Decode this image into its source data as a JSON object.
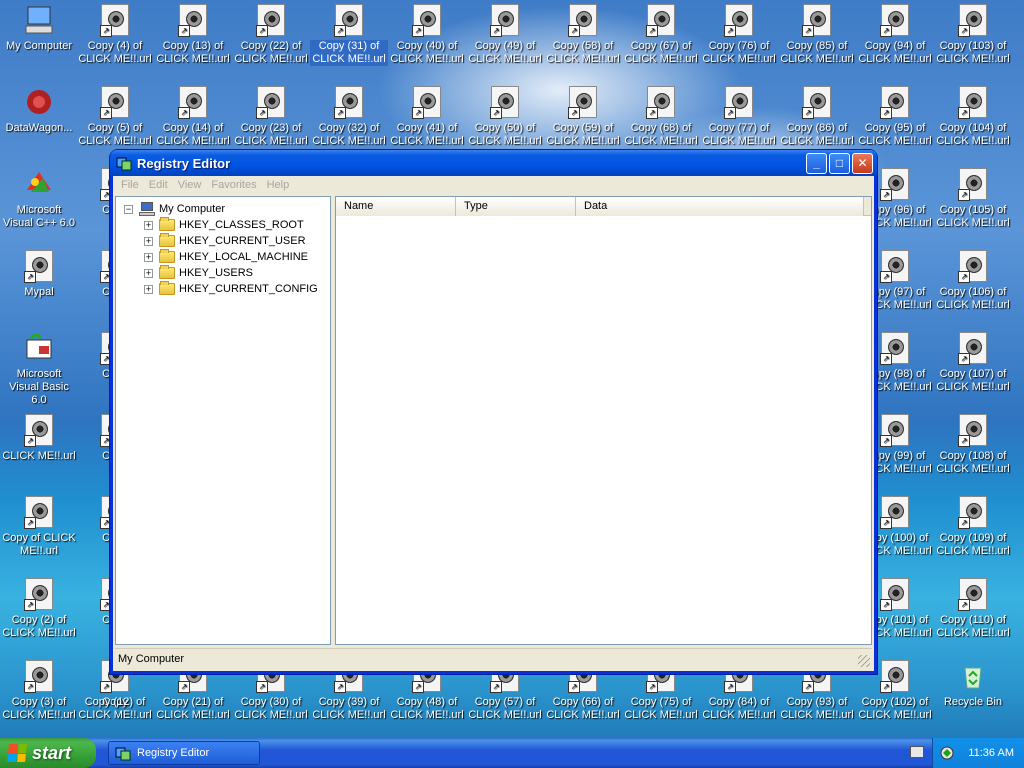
{
  "desktop": {
    "left_icons": [
      {
        "label": "My Computer",
        "icon": "my-computer-icon"
      },
      {
        "label": "DataWagon...",
        "icon": "datawagon-icon"
      },
      {
        "label": "Microsoft Visual C++ 6.0",
        "icon": "visual-cpp-icon"
      },
      {
        "label": "Mypal",
        "icon": "mypal-icon"
      },
      {
        "label": "Microsoft Visual Basic 6.0",
        "icon": "visual-basic-icon"
      },
      {
        "label": "CLICK ME!!.url",
        "icon": "url-shortcut-icon"
      },
      {
        "label": "Copy of CLICK ME!!.url",
        "icon": "url-shortcut-icon"
      },
      {
        "label": "Copy (2) of CLICK ME!!.url",
        "icon": "url-shortcut-icon"
      },
      {
        "label": "Copy (3) of CLICK ME!!.url",
        "icon": "url-shortcut-icon"
      }
    ],
    "top_row": [
      "Copy (4) of CLICK ME!!.url",
      "Copy (13) of CLICK ME!!.url",
      "Copy (22) of CLICK ME!!.url",
      "Copy (31) of CLICK ME!!.url",
      "Copy (40) of CLICK ME!!.url",
      "Copy (49) of CLICK ME!!.url",
      "Copy (58) of CLICK ME!!.url",
      "Copy (67) of CLICK ME!!.url",
      "Copy (76) of CLICK ME!!.url",
      "Copy (85) of CLICK ME!!.url",
      "Copy (94) of CLICK ME!!.url",
      "Copy (103) of CLICK ME!!.url"
    ],
    "second_row": [
      "Copy (5) of CLICK ME!!.url",
      "Copy (14) of CLICK ME!!.url",
      "Copy (23) of CLICK ME!!.url",
      "Copy (32) of CLICK ME!!.url",
      "Copy (41) of CLICK ME!!.url",
      "Copy (50) of CLICK ME!!.url",
      "Copy (59) of CLICK ME!!.url",
      "Copy (68) of CLICK ME!!.url",
      "Copy (77) of CLICK ME!!.url",
      "Copy (86) of CLICK ME!!.url",
      "Copy (95) of CLICK ME!!.url",
      "Copy (104) of CLICK ME!!.url"
    ],
    "bottom_row": [
      "Copy (12) of CLICK ME!!.url",
      "Copy (21) of CLICK ME!!.url",
      "Copy (30) of CLICK ME!!.url",
      "Copy (39) of CLICK ME!!.url",
      "Copy (48) of CLICK ME!!.url",
      "Copy (57) of CLICK ME!!.url",
      "Copy (66) of CLICK ME!!.url",
      "Copy (75) of CLICK ME!!.url",
      "Copy (84) of CLICK ME!!.url",
      "Copy (93) of CLICK ME!!.url",
      "Copy (102) of CLICK ME!!.url"
    ],
    "col_left_partial": [
      "Copy",
      "Copy",
      "Copy",
      "Copy",
      "Copy",
      "Copy",
      "Copy"
    ],
    "col_right_a": [
      "Copy (96) of CLICK ME!!.url",
      "Copy (97) of CLICK ME!!.url",
      "Copy (98) of CLICK ME!!.url",
      "Copy (99) of CLICK ME!!.url",
      "Copy (100) of CLICK ME!!.url",
      "Copy (101) of CLICK ME!!.url"
    ],
    "col_right_b": [
      "Copy (105) of CLICK ME!!.url",
      "Copy (106) of CLICK ME!!.url",
      "Copy (107) of CLICK ME!!.url",
      "Copy (108) of CLICK ME!!.url",
      "Copy (109) of CLICK ME!!.url",
      "Copy (110) of CLICK ME!!.url"
    ],
    "recycle_bin": "Recycle Bin",
    "selected_index": 3
  },
  "window": {
    "title": "Registry Editor",
    "minimize": "_",
    "maximize": "□",
    "close": "✕",
    "menu": [
      "File",
      "Edit",
      "View",
      "Favorites",
      "Help"
    ],
    "tree": {
      "root": "My Computer",
      "root_expander": "−",
      "child_expander": "+",
      "children": [
        "HKEY_CLASSES_ROOT",
        "HKEY_CURRENT_USER",
        "HKEY_LOCAL_MACHINE",
        "HKEY_USERS",
        "HKEY_CURRENT_CONFIG"
      ]
    },
    "columns": [
      "Name",
      "Type",
      "Data"
    ],
    "status": "My Computer"
  },
  "taskbar": {
    "start_label": "start",
    "task_label": "Registry Editor",
    "clock": "11:36 AM"
  },
  "colors": {
    "titlebar": "#0054e3",
    "start_green": "#37a037",
    "taskbar_blue": "#2157d7",
    "selection": "#316ac5"
  }
}
